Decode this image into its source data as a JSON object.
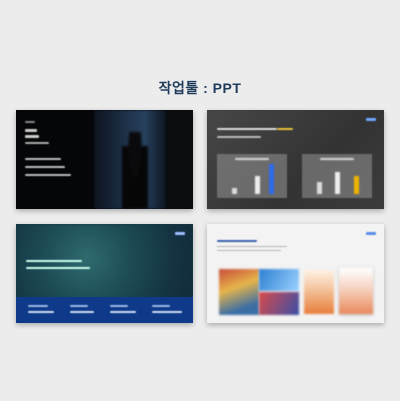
{
  "header": {
    "title": "작업툴 : PPT"
  },
  "slides": [
    {
      "label": "slide-1"
    },
    {
      "label": "slide-2"
    },
    {
      "label": "slide-3"
    },
    {
      "label": "slide-4"
    }
  ],
  "colors": {
    "title": "#1f3b5c",
    "background": "#ececec",
    "accent_blue": "#2f6be8",
    "accent_yellow": "#f0b400",
    "band_blue": "#0f3a8a"
  }
}
